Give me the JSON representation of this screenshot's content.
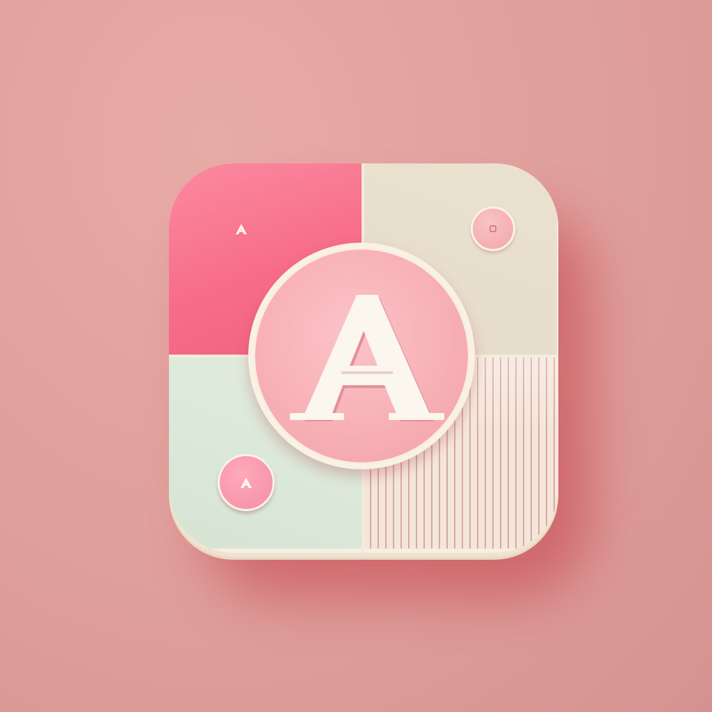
{
  "app_icon": {
    "center_letter": "A",
    "shape": "rounded-square",
    "quadrant_colors": {
      "top_left": "#f76d89",
      "top_right": "#e6dccb",
      "bottom_left": "#dde9da",
      "bottom_right": "#f4e6da"
    },
    "accent_color": "#f7b0b6",
    "background_color": "#df9f9b",
    "ornaments": [
      {
        "kind": "small-letter-a-mark",
        "position": "top-left"
      },
      {
        "kind": "pink-button",
        "position": "top-right"
      },
      {
        "kind": "pink-button-with-letter",
        "position": "bottom-left"
      },
      {
        "kind": "vertical-stripes",
        "position": "bottom-right"
      }
    ]
  }
}
